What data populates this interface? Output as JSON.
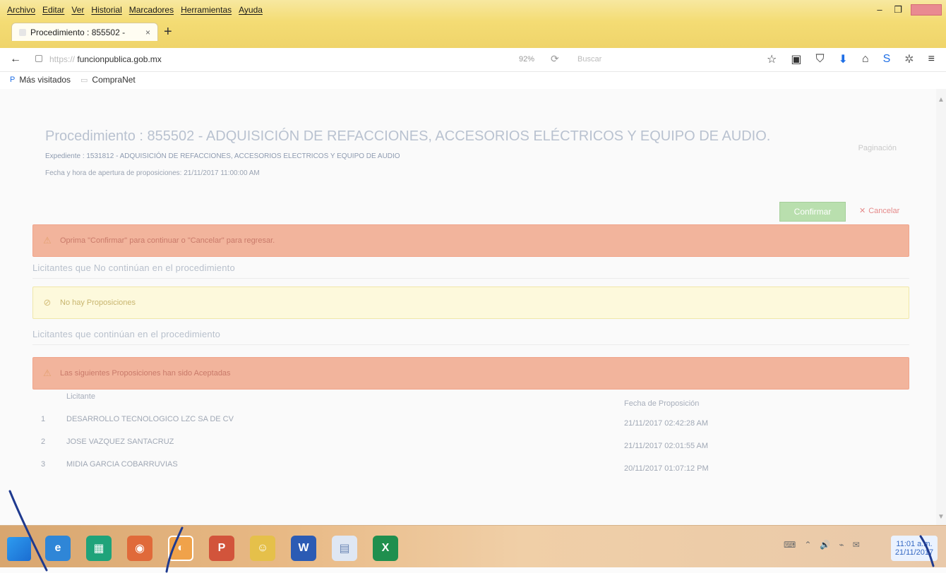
{
  "menu": {
    "items": [
      "Archivo",
      "Editar",
      "Ver",
      "Historial",
      "Marcadores",
      "Herramientas",
      "Ayuda"
    ]
  },
  "tab": {
    "title": "Procedimiento : 855502 - "
  },
  "addressbar": {
    "url_prefix": "https://",
    "url_domain": "funcionpublica.gob.mx",
    "zoom": "92%",
    "search_placeholder": "Buscar"
  },
  "bookmarks": {
    "items": [
      {
        "label": "Más visitados"
      },
      {
        "label": "CompraNet"
      }
    ]
  },
  "page": {
    "title": "Procedimiento : 855502 - ADQUISICIÓN DE REFACCIONES, ACCESORIOS ELÉCTRICOS Y EQUIPO DE AUDIO.",
    "expediente": "Expediente : 1531812 - ADQUISICIÓN DE REFACCIONES, ACCESORIOS ELECTRICOS Y EQUIPO DE AUDIO",
    "apertura": "Fecha y hora de apertura de proposiciones: 21/11/2017 11:00:00 AM",
    "paginate_label": "Paginación",
    "confirm_label": "Confirmar",
    "cancel_label": "Cancelar",
    "alert_confirm": "Oprima \"Confirmar\" para continuar o \"Cancelar\" para regresar.",
    "section_no_continue": "Licitantes que No continúan en el procedimiento",
    "no_proposals": "No hay Proposiciones",
    "section_continue": "Licitantes que continúan en el procedimiento",
    "accepted_alert": "Las siguientes Proposiciones han sido Aceptadas",
    "table": {
      "col_licitante": "Licitante",
      "col_fecha": "Fecha de Proposición",
      "rows": [
        {
          "num": "1",
          "name": "DESARROLLO TECNOLOGICO LZC SA DE CV",
          "date": "21/11/2017 02:42:28 AM"
        },
        {
          "num": "2",
          "name": "JOSE VAZQUEZ SANTACRUZ",
          "date": "21/11/2017 02:01:55 AM"
        },
        {
          "num": "3",
          "name": "MIDIA GARCIA COBARRUVIAS",
          "date": "20/11/2017 01:07:12 PM"
        }
      ]
    },
    "ghost1": "",
    "ghost2": ""
  },
  "taskbar": {
    "clock_time": "11:01 a.m.",
    "clock_date": "21/11/2017"
  },
  "colors": {
    "chrome_bg": "#f4dc74",
    "alert_red": "#f2b49c",
    "alert_yellow": "#fdf9dc",
    "confirm_green": "#b9dfae",
    "cancel_red": "#e58a8a",
    "taskbar_bg": "#e8b985"
  }
}
